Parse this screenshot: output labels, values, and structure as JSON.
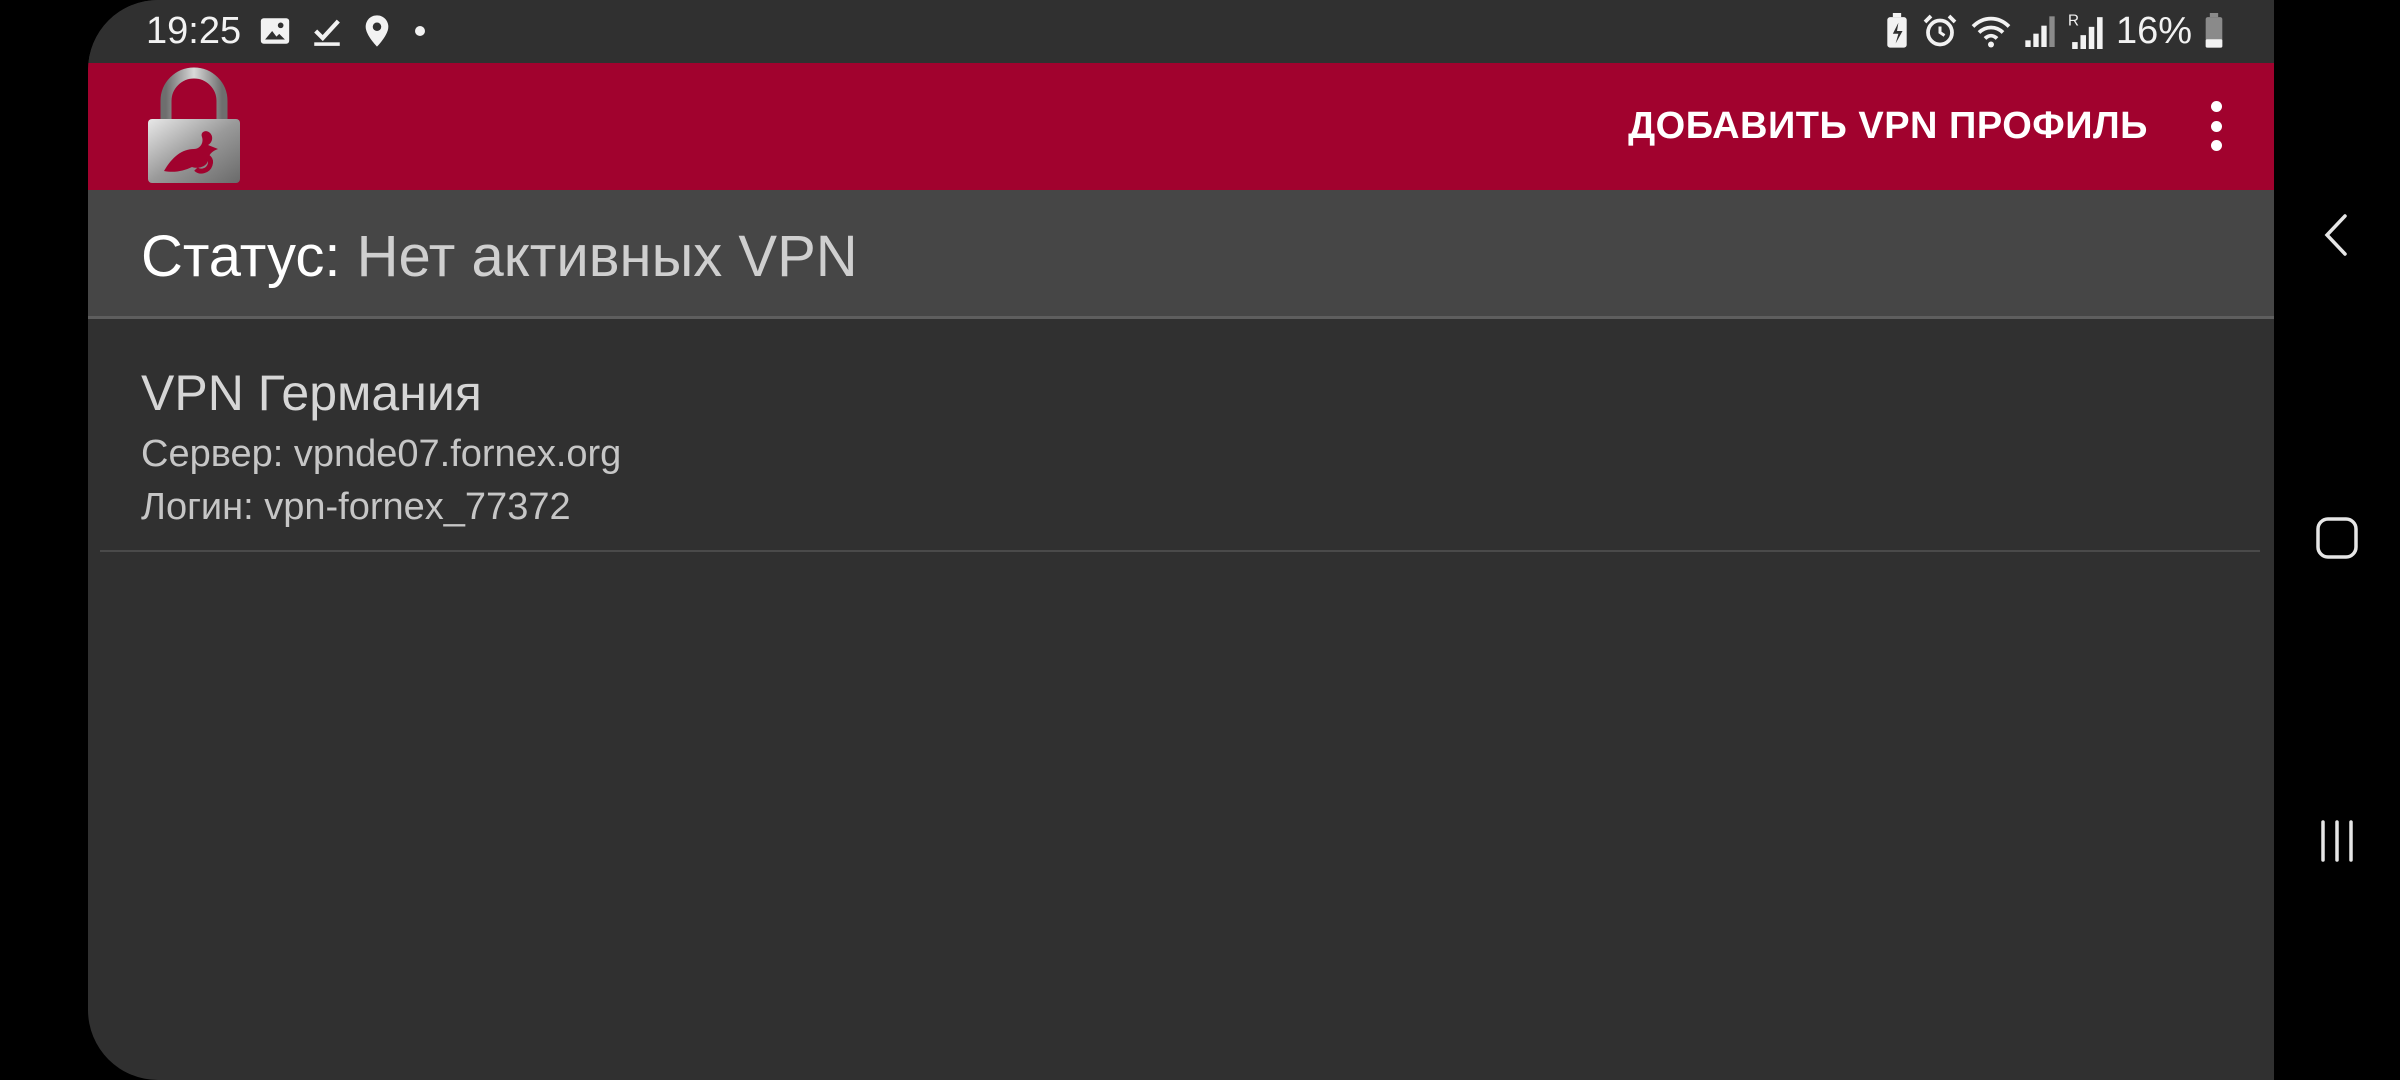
{
  "status_bar": {
    "time": "19:25",
    "left_icons": [
      "image-icon",
      "download-done-icon",
      "location-pin-icon",
      "dot-icon"
    ],
    "right_icons": [
      "battery-saver-icon",
      "alarm-icon",
      "wifi-icon",
      "signal-icon",
      "signal-roaming-icon"
    ],
    "battery_percent": "16%"
  },
  "toolbar": {
    "logo": "padlock-logo",
    "add_profile_label": "ДОБАВИТЬ VPN ПРОФИЛЬ",
    "overflow_icon": "more-vert-icon",
    "brand_color": "#a1022e"
  },
  "status": {
    "key": "Статус:",
    "value": "Нет активных VPN"
  },
  "profiles": [
    {
      "name": "VPN Германия",
      "server": "Сервер: vpnde07.fornex.org",
      "login": "Логин: vpn-fornex_77372"
    }
  ],
  "nav_bar": {
    "back": "back-icon",
    "home": "home-icon",
    "recents": "recents-icon"
  }
}
